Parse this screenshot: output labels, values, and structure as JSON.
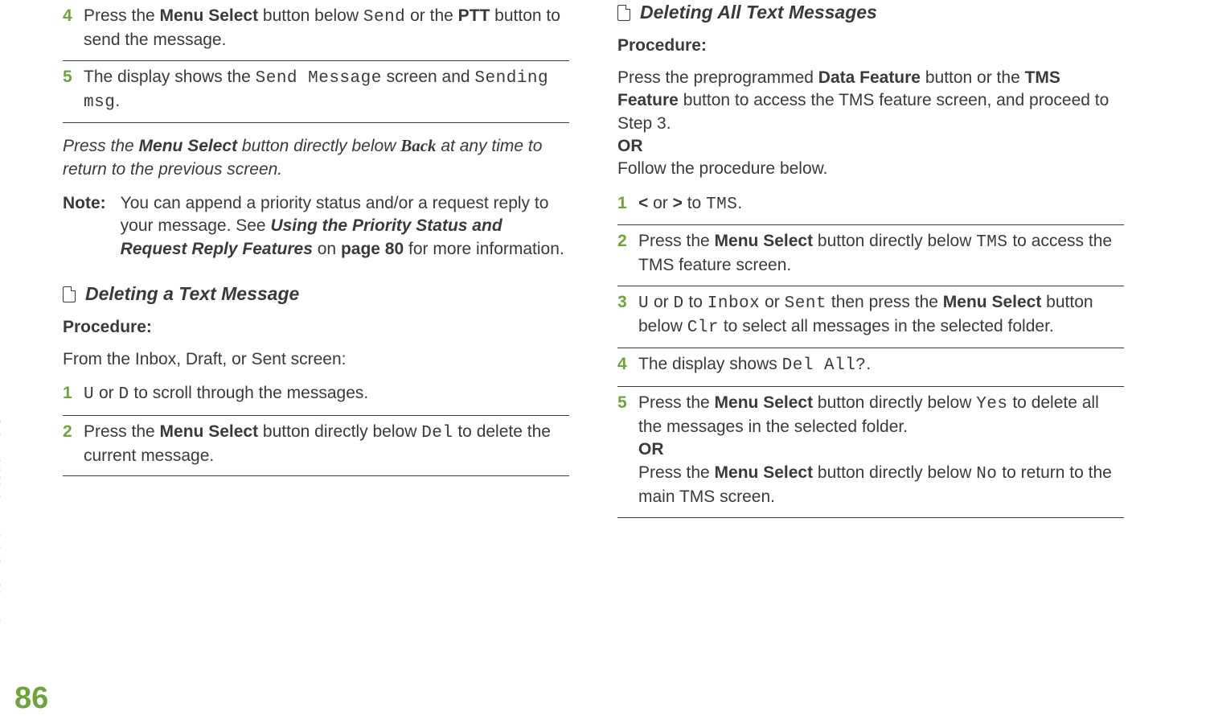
{
  "sideLabel": "Advanced Features",
  "pageNumber": "86",
  "left": {
    "step4": {
      "num": "4",
      "t1": "Press the ",
      "b1": "Menu Select",
      "t2": " button below ",
      "m1": "Send",
      "t3": " or the ",
      "b2": "PTT",
      "t4": " button to send the message."
    },
    "step5": {
      "num": "5",
      "t1": "The display shows the ",
      "m1": "Send Message",
      "t2": " screen and ",
      "m2": "Sending msg",
      "t3": "."
    },
    "backline": {
      "t1": "Press the ",
      "b1": "Menu Select",
      "t2": " button directly below ",
      "back": "Back",
      "t3": " at any time to return to the previous screen."
    },
    "note": {
      "label": "Note:",
      "t1": "You can append a priority status and/or a request reply to your message. See ",
      "bi1": "Using the Priority Status and Request Reply Features",
      "t2": " on ",
      "b2": "page 80",
      "t3": " for more information."
    },
    "sub1": "Deleting a Text Message",
    "procLabel": "Procedure:",
    "fromLine": "From the Inbox, Draft, or Sent screen:",
    "d1": {
      "num": "1",
      "u": "U",
      "t1": " or ",
      "d": "D",
      "t2": " to scroll through the messages."
    },
    "d2": {
      "num": "2",
      "t1": "Press the ",
      "b1": "Menu Select",
      "t2": " button directly below ",
      "m1": "Del",
      "t3": " to delete the current message."
    }
  },
  "right": {
    "sub2": "Deleting All Text Messages",
    "procLabel": "Procedure:",
    "intro": {
      "t1": "Press the preprogrammed ",
      "b1": "Data Feature",
      "t2": " button or the ",
      "b2": "TMS Feature",
      "t3": " button to access the TMS feature screen, and proceed to",
      "t4": "Step 3.",
      "or": "OR",
      "t5": "Follow the procedure below."
    },
    "s1": {
      "num": "1",
      "lt": "<",
      "t1": " or ",
      "gt": ">",
      "t2": " to ",
      "m1": "TMS",
      "t3": "."
    },
    "s2": {
      "num": "2",
      "t1": "Press the ",
      "b1": "Menu Select",
      "t2": " button directly below ",
      "m1": "TMS",
      "t3": " to access the TMS feature screen."
    },
    "s3": {
      "num": "3",
      "u": "U",
      "t1": " or ",
      "d": "D",
      "t2": " to ",
      "m1": "Inbox",
      "t3": " or ",
      "m2": "Sent",
      "t4": " then press the ",
      "b1": "Menu Select",
      "t5": " button below ",
      "m3": "Clr",
      "t6": " to select all messages in the selected folder."
    },
    "s4": {
      "num": "4",
      "t1": "The display shows ",
      "m1": "Del All?",
      "t2": "."
    },
    "s5": {
      "num": "5",
      "t1": "Press the ",
      "b1": "Menu Select",
      "t2": " button directly below ",
      "m1": "Yes",
      "t3": " to delete all the messages in the selected folder.",
      "or": "OR",
      "t4": "Press the ",
      "b2": "Menu Select",
      "t5": " button directly below ",
      "m2": "No",
      "t6": " to return to the main TMS screen."
    }
  }
}
